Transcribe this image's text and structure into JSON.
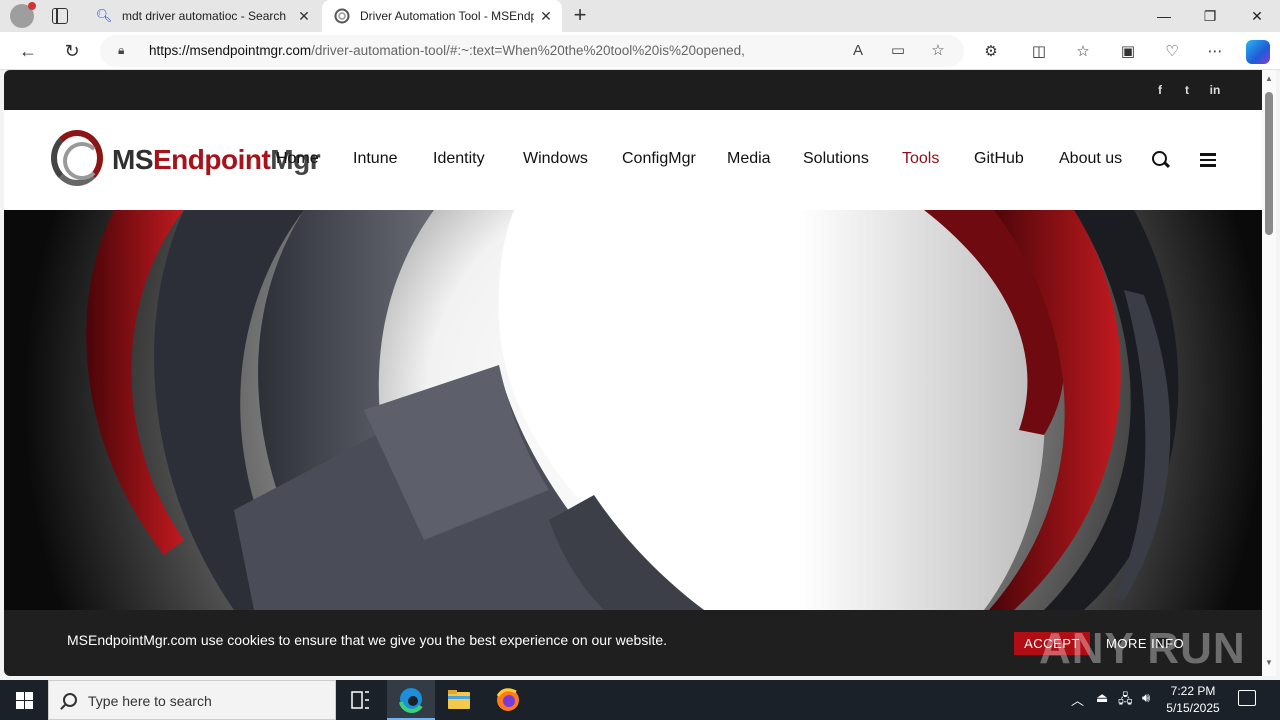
{
  "browser": {
    "tabs": [
      {
        "title": "mdt driver automatioc - Search",
        "active": false,
        "favicon": "search-icon"
      },
      {
        "title": "Driver Automation Tool - MSEndp",
        "active": true,
        "favicon": "msendpointmgr-favicon"
      }
    ],
    "new_tab": "+",
    "url_host": "https://msendpointmgr.com",
    "url_rest": "/driver-automation-tool/#:~:text=When%20the%20tool%20is%20opened,"
  },
  "site": {
    "logo": {
      "ms": "MS",
      "endpoint": "Endpoint",
      "mgr": "Mgr"
    },
    "social": [
      "f",
      "t",
      "in"
    ],
    "nav": [
      "Home",
      "Intune",
      "Identity",
      "Windows",
      "ConfigMgr",
      "Media",
      "Solutions",
      "Tools",
      "GitHub",
      "About us"
    ],
    "active_nav": "Tools",
    "accent_color": "#8c0f1a"
  },
  "cookie": {
    "message": "MSEndpointMgr.com use cookies to ensure that we give you the best experience on our website.",
    "accept": "ACCEPT",
    "more_info": "MORE INFO"
  },
  "watermark": "ANY RUN",
  "taskbar": {
    "search_placeholder": "Type here to search",
    "time": "7:22 PM",
    "date": "5/15/2025"
  }
}
